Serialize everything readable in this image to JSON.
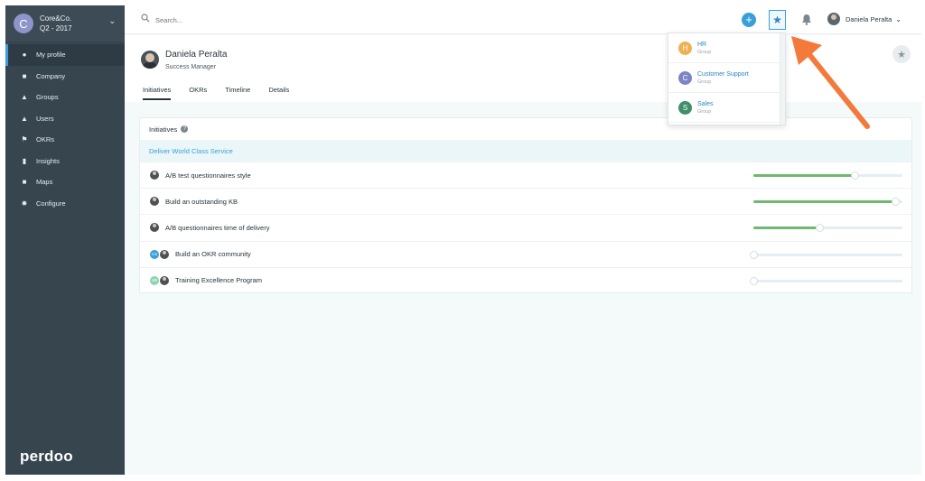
{
  "org": {
    "avatar_letter": "C",
    "name": "Core&Co.",
    "period": "Q2 - 2017"
  },
  "nav": [
    {
      "label": "My profile",
      "icon": "user-icon",
      "glyph": "●"
    },
    {
      "label": "Company",
      "icon": "briefcase-icon",
      "glyph": "■"
    },
    {
      "label": "Groups",
      "icon": "groups-icon",
      "glyph": "▲"
    },
    {
      "label": "Users",
      "icon": "person-icon",
      "glyph": "▲"
    },
    {
      "label": "OKRs",
      "icon": "flag-icon",
      "glyph": "⚑"
    },
    {
      "label": "Insights",
      "icon": "bar-chart-icon",
      "glyph": "▮"
    },
    {
      "label": "Maps",
      "icon": "map-icon",
      "glyph": "■"
    },
    {
      "label": "Configure",
      "icon": "gear-icon",
      "glyph": "✹"
    }
  ],
  "brand": "perdoo",
  "search": {
    "placeholder": "Search..."
  },
  "topbar": {
    "plus": "+",
    "star": "★",
    "user_name": "Daniela Peralta",
    "chevron": "⌄"
  },
  "profile": {
    "name": "Daniela Peralta",
    "role": "Success Manager",
    "tabs": [
      "Initiatives",
      "OKRs",
      "Timeline",
      "Details"
    ],
    "fav_star": "★"
  },
  "initiatives": {
    "header": "Initiatives",
    "help": "?",
    "group_label": "Deliver World Class Service",
    "rows": [
      {
        "label": "A/B test questionnaires style",
        "progress": 0.68,
        "group_badge": ""
      },
      {
        "label": "Build an outstanding KB",
        "progress": 0.95,
        "group_badge": ""
      },
      {
        "label": "A/B questionnaires time of delivery",
        "progress": 0.44,
        "group_badge": ""
      },
      {
        "label": "Build an OKR community",
        "progress": 0.0,
        "group_badge": "CS"
      },
      {
        "label": "Training Excellence Program",
        "progress": 0.0,
        "group_badge": "HR"
      }
    ]
  },
  "favorites_dropdown": [
    {
      "letter": "H",
      "name": "HR",
      "type": "Group",
      "color": "#f0b155"
    },
    {
      "letter": "C",
      "name": "Customer Support",
      "type": "Group",
      "color": "#7d86c4"
    },
    {
      "letter": "S",
      "name": "Sales",
      "type": "Group",
      "color": "#3f8f6a"
    }
  ],
  "colors": {
    "accent": "#3a9fd8",
    "sidebar": "#37454f",
    "progress": "#6fb86f",
    "arrow": "#f47a3c"
  }
}
